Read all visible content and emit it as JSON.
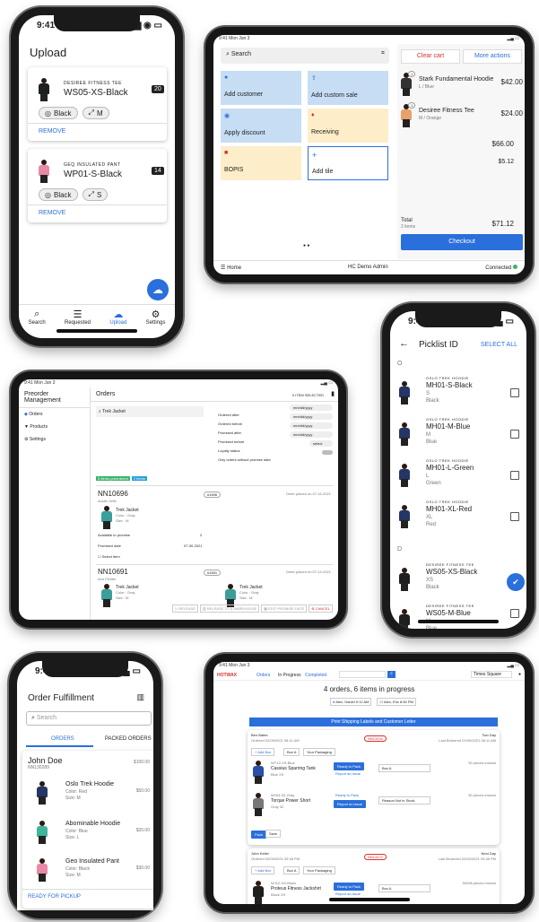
{
  "upload": {
    "time": "9:41",
    "title": "Upload",
    "items": [
      {
        "brand": "DESIREE FITNESS TEE",
        "sku": "WS05-XS-Black",
        "count": "20",
        "chips": [
          "Black",
          "M"
        ],
        "remove": "REMOVE"
      },
      {
        "brand": "GEQ INSULATED PANT",
        "sku": "WP01-S-Black",
        "count": "14",
        "chips": [
          "Black",
          "S"
        ],
        "remove": "REMOVE"
      }
    ],
    "nav": [
      "Search",
      "Requested",
      "Upload",
      "Settings"
    ]
  },
  "pos": {
    "status": "9:41  Mon Jun 3",
    "search_placeholder": "Search",
    "tiles": [
      "Add customer",
      "Add custom sale",
      "Apply discount",
      "Receiving",
      "BOPIS",
      "Add tile"
    ],
    "clear": "Clear cart",
    "more": "More actions",
    "cart": [
      {
        "name": "Stark Fundamental Hoodie",
        "var": "L / Blue",
        "qty": "1",
        "price": "$42.00"
      },
      {
        "name": "Desiree Fitness Tee",
        "var": "M / Orange",
        "qty": "1",
        "price": "$24.00"
      }
    ],
    "subtotal": "$66.00",
    "tax": "$5.12",
    "total_label": "Total",
    "total_items": "2 items",
    "total": "$71.12",
    "checkout": "Checkout",
    "home": "Home",
    "user": "HC Demo Admin",
    "connected": "Connected"
  },
  "picklist": {
    "time": "9:41",
    "title": "Picklist ID",
    "select_all": "SELECT ALL",
    "groups": [
      {
        "letter": "O",
        "items": [
          {
            "brand": "OSLO TREK HOODIE",
            "sku": "MH01-S-Black",
            "size": "S",
            "color": "Black"
          },
          {
            "brand": "OSLO TREK HOODIE",
            "sku": "MH01-M-Blue",
            "size": "M",
            "color": "Blue"
          },
          {
            "brand": "OSLO TREK HOODIE",
            "sku": "MH01-L-Green",
            "size": "L",
            "color": "Green"
          },
          {
            "brand": "OSLO TREK HOODIE",
            "sku": "MH01-XL-Red",
            "size": "XL",
            "color": "Red"
          }
        ]
      },
      {
        "letter": "D",
        "items": [
          {
            "brand": "DESIREE FITNESS TEE",
            "sku": "WS05-XS-Black",
            "size": "XS",
            "color": "Black"
          },
          {
            "brand": "DESIREE FITNESS TEE",
            "sku": "WS05-M-Blue",
            "size": "M",
            "color": "Blue"
          }
        ]
      }
    ]
  },
  "preorder": {
    "status": "9:41  Mon Jun 3",
    "app": "Preorder Management",
    "menu": [
      "Orders",
      "Products",
      "Settings"
    ],
    "page": "Orders",
    "selected": "0 ITEM SELECTED",
    "search_value": "Trek Jacket",
    "filters": [
      {
        "label": "Ordered after",
        "value": "mm/dd/yyyy"
      },
      {
        "label": "Ordered before",
        "value": "mm/dd/yyyy"
      },
      {
        "label": "Promised after",
        "value": "mm/dd/yyyy"
      },
      {
        "label": "Promised before",
        "value": "mm/dd/yyyy"
      },
      {
        "label": "Loyalty status",
        "value": "select"
      }
    ],
    "toggle_label": "Only orders without promise date",
    "tags": [
      "5 Items preordered",
      "2 Items"
    ],
    "orders": [
      {
        "id": "NN10696",
        "name": "Austin Jeffs",
        "badge": "#1696",
        "placed": "Order placed on 07-16-2021",
        "item": "Trek Jacket",
        "item_color": "Color : Gray",
        "item_size": "Size : M",
        "avail_label": "Available to promise",
        "avail": "2",
        "promised_label": "Promised date",
        "promised": "07-30-2021",
        "select": "Select Item"
      },
      {
        "id": "NN10691",
        "name": "Ann Fielder",
        "badge": "#1691",
        "placed": "Order placed on 07-14-2021",
        "item": "Trek Jacket",
        "item_color": "Color : Gray",
        "item_size": "Size : M",
        "item2": "Trek Jacket",
        "item2_color": "Color : Gray",
        "item2_size": "Size : M"
      }
    ],
    "actions": [
      "RELEASE",
      "RELEASE TO A WAREHOUSE",
      "EDIT PROMISE DATE",
      "CANCEL"
    ]
  },
  "fulfillment": {
    "time": "9:41",
    "title": "Order Fulfillment",
    "search_placeholder": "Search",
    "tabs": [
      "ORDERS",
      "PACKED ORDERS"
    ],
    "customer": "John Doe",
    "order_id": "NN130289",
    "order_total": "$100.00",
    "items": [
      {
        "name": "Oslo Trek Hoodie",
        "color": "Color: Red",
        "size": "Size: M",
        "price": "$50.00"
      },
      {
        "name": "Abominable Hoodie",
        "color": "Color: Blue",
        "size": "Size: L",
        "price": "$20.00"
      },
      {
        "name": "Geo Insulated Pant",
        "color": "Color: Black",
        "size": "Size: M",
        "price": "$30.00"
      }
    ],
    "ready": "READY FOR PICKUP"
  },
  "packing": {
    "status": "9:41  Mon Jun 3",
    "brand": "HOTWAX",
    "tabs": [
      "Orders",
      "In Progress",
      "Completed"
    ],
    "store": "Times Square",
    "summary": "4 orders, 6 items in progress",
    "pickers": [
      {
        "name": "Alex, Daniel",
        "time": "9:12 AM"
      },
      {
        "name": "Alex, Eric",
        "time": "8:50 PM"
      }
    ],
    "print": "Print Shipping Labels and Customer Letter",
    "orders": [
      {
        "customer": "Ben Bates",
        "ordered": "Ordered 02/09/2021 08:11 AM",
        "badge": "NN13434",
        "ship": "Two Day",
        "brokered": "Last Brokered 02/09/2021 08:11 AM",
        "add_box": "+ Add Box",
        "box": "Box A",
        "packaging": "Your Packaging",
        "items": [
          {
            "sku": "WT12-XS-Blue",
            "name": "Cassius Sparring Tank",
            "variant": "Blue XS",
            "action": "Ready to Pack",
            "issue": "Report an issue",
            "sel_label": "Box",
            "sel": "A",
            "stock": "50 pieces instock"
          },
          {
            "sku": "MS04-32-Gray",
            "name": "Torque Power Short",
            "variant": "Gray 32",
            "action": "Ready to Pack",
            "issue": "Report an issue",
            "sel_label": "Reason",
            "sel": "Not in Stock",
            "stock": "50 pieces instock"
          }
        ],
        "pack": "Pack",
        "save": "Save"
      },
      {
        "customer": "John Keller",
        "ordered": "Ordered 02/09/2021 09:48 PM",
        "badge": "NN13472",
        "ship": "Next Day",
        "brokered": "Last Brokered 02/09/2021 09:48 PM",
        "add_box": "+ Add Box",
        "box": "Box A",
        "packaging": "Your Packaging",
        "items": [
          {
            "sku": "WJ12-XS-Black",
            "name": "Proteus Fitness Jackshirt",
            "variant": "Black XS",
            "action": "Ready to Pack",
            "issue": "Report an issue",
            "sel_label": "Box",
            "sel": "A",
            "stock": "50498 pieces instock"
          }
        ]
      }
    ]
  },
  "colors": {
    "accent": "#2a6fdb",
    "tile_blue": "#c6ddf4",
    "tile_yellow": "#fdeec9",
    "clear_red": "#d9302c",
    "badge_red": "#d9302c"
  }
}
